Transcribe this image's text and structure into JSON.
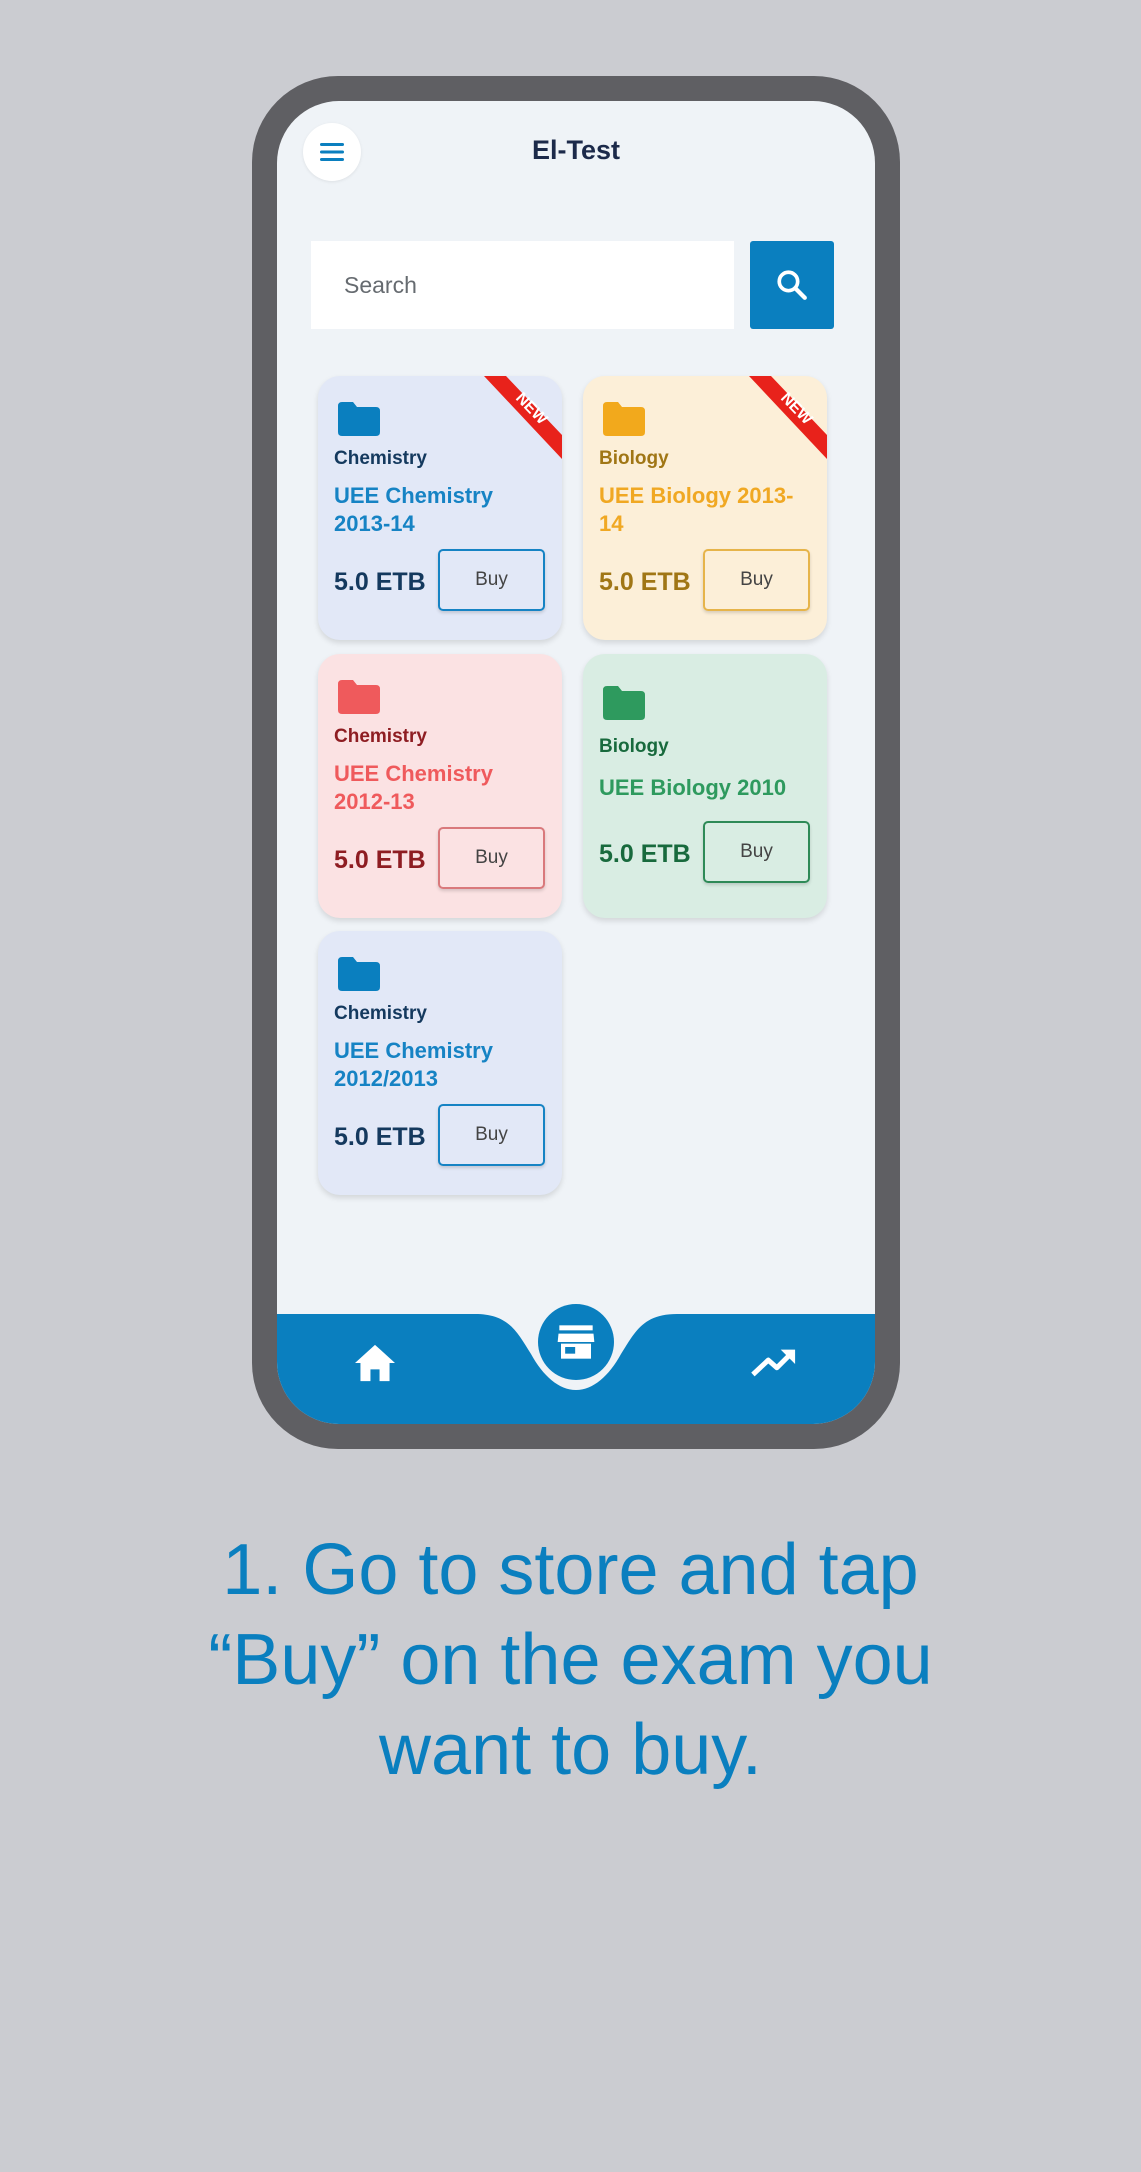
{
  "app": {
    "title": "El-Test"
  },
  "search": {
    "placeholder": "Search"
  },
  "cards": [
    {
      "category": "Chemistry",
      "title": "UEE Chemistry 2013-14",
      "price": "5.0 ETB",
      "buy_label": "Buy",
      "badge": "NEW",
      "color_theme": "blue"
    },
    {
      "category": "Biology",
      "title": "UEE Biology 2013-14",
      "price": "5.0 ETB",
      "buy_label": "Buy",
      "badge": "NEW",
      "color_theme": "yellow"
    },
    {
      "category": "Chemistry",
      "title": "UEE Chemistry 2012-13",
      "price": "5.0 ETB",
      "buy_label": "Buy",
      "color_theme": "red"
    },
    {
      "category": "Biology",
      "title": "UEE Biology 2010",
      "price": "5.0 ETB",
      "buy_label": "Buy",
      "color_theme": "green"
    },
    {
      "category": "Chemistry",
      "title": "UEE Chemistry 2012/2013",
      "price": "5.0 ETB",
      "buy_label": "Buy",
      "color_theme": "blue"
    }
  ],
  "bottom_nav": {
    "items": [
      "home-icon",
      "store-icon",
      "trending-up-icon"
    ],
    "active": "store-icon"
  },
  "caption": {
    "line1": "1. Go to store and tap",
    "line2": "“Buy” on the exam you",
    "line3": "want to buy."
  },
  "colors": {
    "accent": "#0a7fbf",
    "background": "#cbccd1",
    "screen": "#eff3f7",
    "badge_red": "#e8221b"
  }
}
